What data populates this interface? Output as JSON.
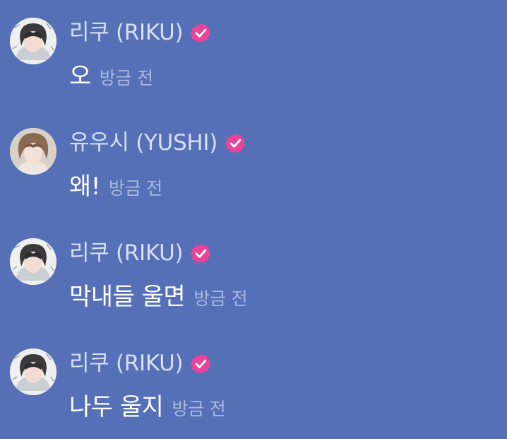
{
  "colors": {
    "background": "#5570b7",
    "name": "#d7dff3",
    "message": "#ffffff",
    "timestamp": "#aab7e0",
    "badge": "#e8449a"
  },
  "messages": [
    {
      "sender": "리쿠 (RIKU)",
      "avatar_icon": "riku-avatar",
      "verified_icon": "verified-badge-icon",
      "text": "오",
      "time": "방금 전"
    },
    {
      "sender": "유우시 (YUSHI)",
      "avatar_icon": "yushi-avatar",
      "verified_icon": "verified-badge-icon",
      "text": "왜!",
      "time": "방금 전"
    },
    {
      "sender": "리쿠 (RIKU)",
      "avatar_icon": "riku-avatar",
      "verified_icon": "verified-badge-icon",
      "text": "막내들 울면",
      "time": "방금 전"
    },
    {
      "sender": "리쿠 (RIKU)",
      "avatar_icon": "riku-avatar",
      "verified_icon": "verified-badge-icon",
      "text": "나두 울지",
      "time": "방금 전"
    }
  ]
}
